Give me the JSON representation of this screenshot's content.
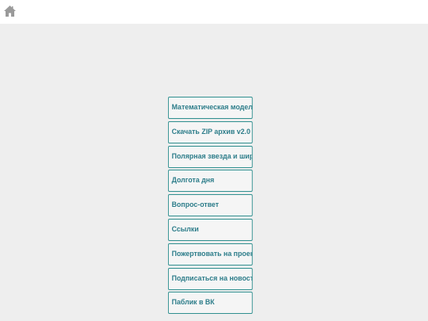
{
  "header": {
    "home_icon": "home-icon"
  },
  "colors": {
    "accent": "#2d7d8a",
    "border": "#2f8f8f",
    "page_bg": "#eeeeee",
    "header_bg": "#ffffff",
    "icon": "#9a9a9a"
  },
  "menu": {
    "items": [
      {
        "label": "Математическая модель ПЗ"
      },
      {
        "label": "Скачать ZIP архив v2.0"
      },
      {
        "label": "Полярная звезда и широты"
      },
      {
        "label": "Долгота дня"
      },
      {
        "label": "Вопрос-ответ"
      },
      {
        "label": "Ссылки"
      },
      {
        "label": "Пожертвовать на проект"
      },
      {
        "label": "Подписаться на новости"
      },
      {
        "label": "Паблик в ВК"
      }
    ]
  }
}
